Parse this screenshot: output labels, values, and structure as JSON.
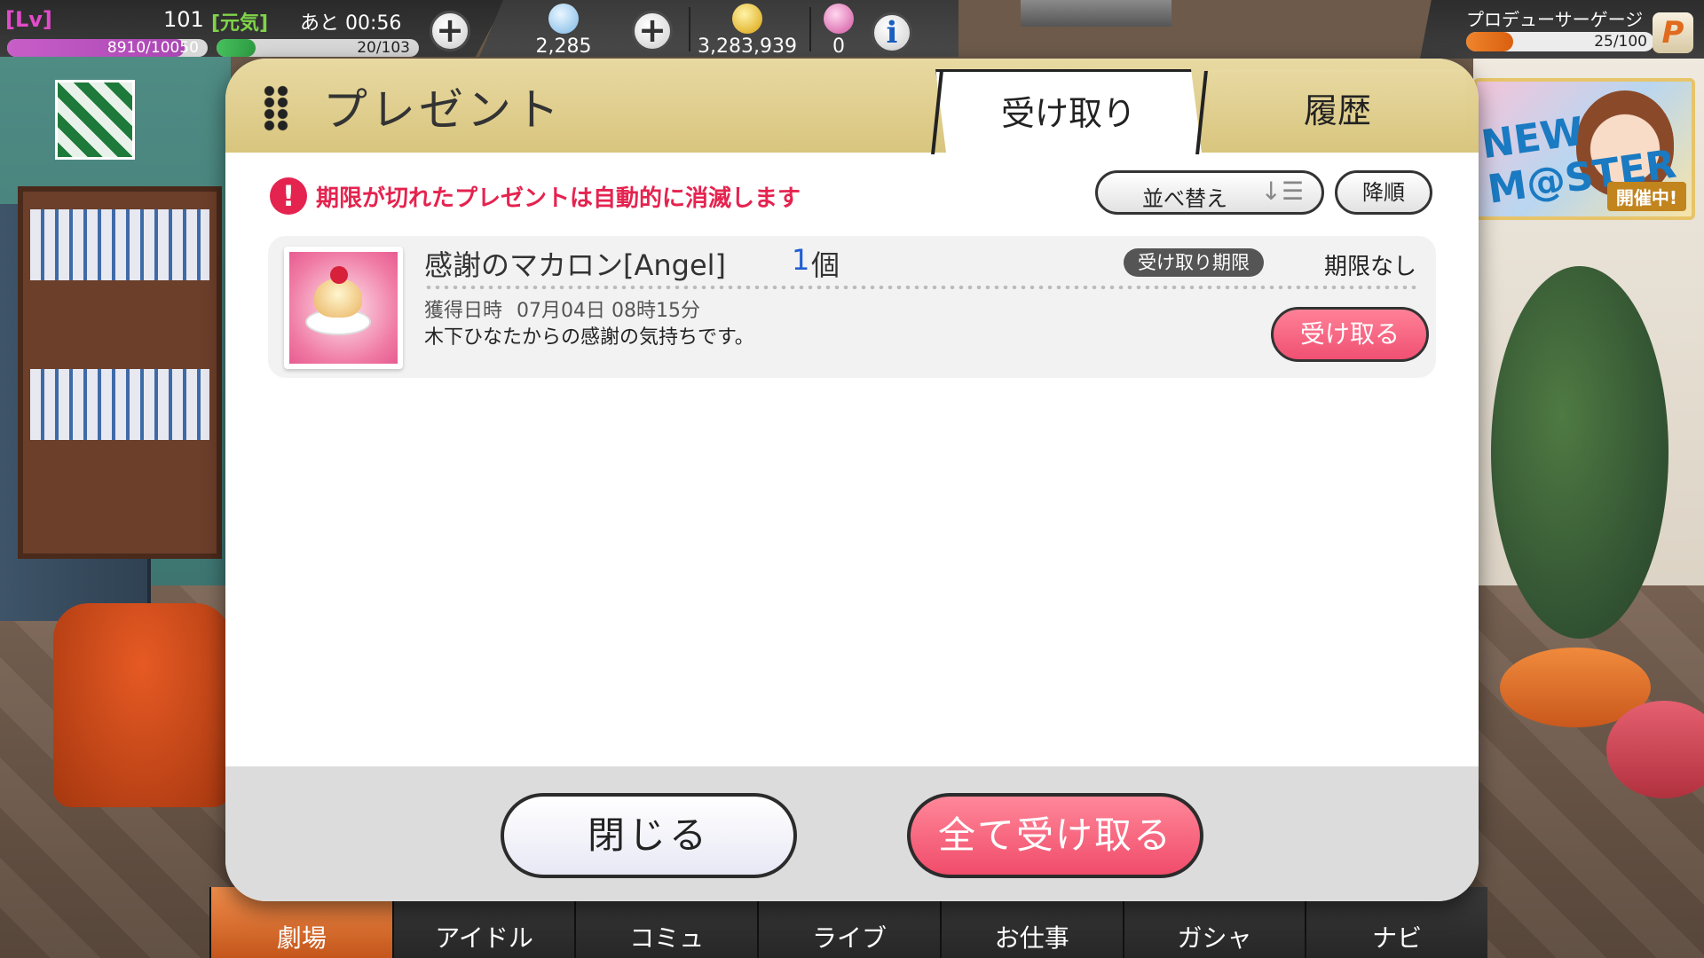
{
  "status": {
    "lv_tag": "[Lv]",
    "level": "101",
    "genki_tag": "[元気]",
    "remaining": "あと 00:56",
    "xp": "8910/10050",
    "xp_fraction": 0.887,
    "stamina": "20/103",
    "stamina_fraction": 0.194,
    "plus_label": "+",
    "gems": "2,285",
    "money": "3,283,939",
    "tickets": "0",
    "info_label": "i"
  },
  "producer": {
    "label": "プロデューサーゲージ",
    "gauge": "25/100",
    "gauge_fraction": 0.25,
    "icon": "P"
  },
  "event_banner": {
    "title": "NEW M@STER",
    "status": "開催中!"
  },
  "modal": {
    "title": "プレゼント",
    "tabs": [
      {
        "label": "受け取り",
        "active": true
      },
      {
        "label": "履歴",
        "active": false
      }
    ],
    "notice": "期限が切れたプレゼントは自動的に消滅します",
    "warn_icon": "!",
    "sort_label": "並べ替え",
    "sort_icon": "↓☰",
    "order_label": "降順",
    "items": [
      {
        "name": "感謝のマカロン[Angel]",
        "count": "1",
        "unit": "個",
        "deadline_tag": "受け取り期限",
        "deadline": "期限なし",
        "acquired_label": "獲得日時",
        "acquired": "07月04日 08時15分",
        "description": "木下ひなたからの感謝の気持ちです。",
        "receive_label": "受け取る",
        "icon": "macaron-icon"
      }
    ],
    "close_label": "閉じる",
    "receive_all_label": "全て受け取る"
  },
  "nav": [
    {
      "label": "劇場",
      "active": true
    },
    {
      "label": "アイドル",
      "active": false
    },
    {
      "label": "コミュ",
      "active": false
    },
    {
      "label": "ライブ",
      "active": false
    },
    {
      "label": "お仕事",
      "active": false
    },
    {
      "label": "ガシャ",
      "active": false
    },
    {
      "label": "ナビ",
      "active": false
    }
  ],
  "colors": {
    "accent_pink": "#f05072",
    "warning_red": "#e5234f",
    "header_gold": "#d8c57e",
    "count_blue": "#1f5fd1"
  }
}
